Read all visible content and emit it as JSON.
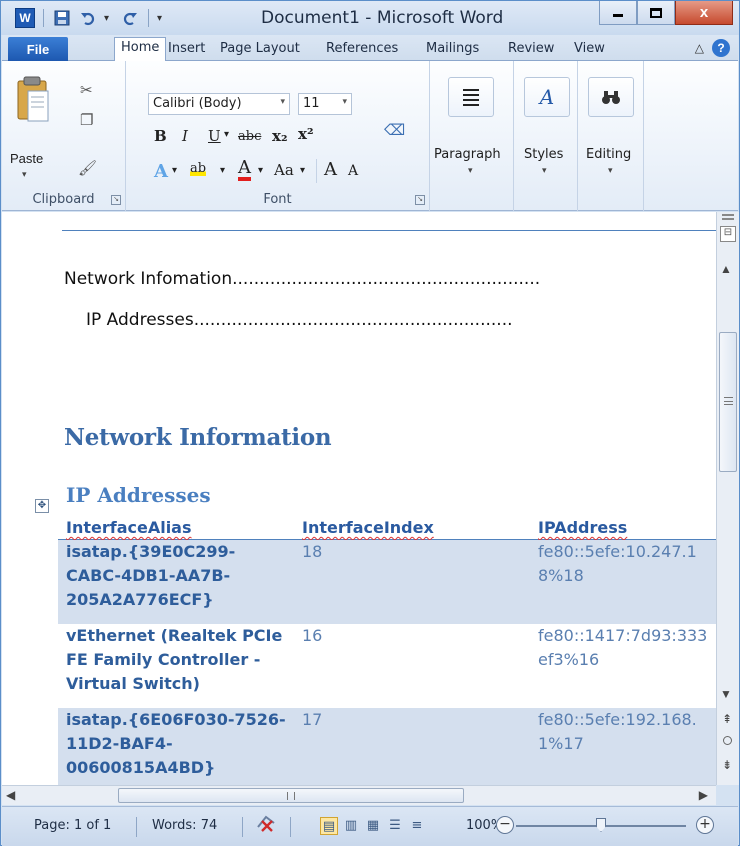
{
  "window": {
    "title": "Document1 - Microsoft Word",
    "close_glyph": "x"
  },
  "quick_access": {
    "app_icon": "W",
    "items": [
      "save-icon",
      "undo-icon",
      "redo-icon",
      "customize-dropdown-icon"
    ]
  },
  "ribbon_tabs": {
    "file": "File",
    "tabs": [
      "Home",
      "Insert",
      "Page Layout",
      "References",
      "Mailings",
      "Review",
      "View"
    ],
    "active": "Home"
  },
  "ribbon": {
    "clipboard": {
      "paste_label": "Paste",
      "group_label": "Clipboard"
    },
    "font": {
      "font_name": "Calibri (Body)",
      "font_size": "11",
      "group_label": "Font",
      "buttons": {
        "bold": "B",
        "italic": "I",
        "underline": "U",
        "strike": "abc",
        "subscript": "x₂",
        "superscript": "x²",
        "font_color": "A",
        "change_case": "Aa",
        "grow": "A",
        "shrink": "A"
      }
    },
    "paragraph": {
      "label": "Paragraph"
    },
    "styles": {
      "label": "Styles"
    },
    "editing": {
      "label": "Editing"
    }
  },
  "document": {
    "toc": [
      {
        "text": "Network Infomation",
        "level": 1
      },
      {
        "text": "IP Addresses",
        "level": 2
      }
    ],
    "heading1": "Network Information",
    "heading2": "IP Addresses",
    "table": {
      "headers": [
        "InterfaceAlias",
        "InterfaceIndex",
        "IPAddress"
      ],
      "rows": [
        {
          "alias": "isatap.{39E0C299-\nCABC-4DB1-AA7B-\n205A2A776ECF}",
          "index": "18",
          "ip": "fe80::5efe:10.247.1\n8%18",
          "shaded": true
        },
        {
          "alias": "vEthernet (Realtek PCIe\nFE Family Controller -\nVirtual Switch)",
          "index": "16",
          "ip": "fe80::1417:7d93:333\nef3%16",
          "shaded": false
        },
        {
          "alias": "isatap.{6E06F030-7526-\n11D2-BAF4-\n00600815A4BD}",
          "index": "17",
          "ip": "fe80::5efe:192.168.\n1%17",
          "shaded": true
        }
      ]
    }
  },
  "status_bar": {
    "page": "Page: 1 of 1",
    "words": "Words: 74",
    "zoom": "100%",
    "zoom_minus": "−",
    "zoom_plus": "+"
  },
  "colors": {
    "heading": "#3b6aa6",
    "table_header": "#2a5aa0",
    "row_shade": "#d4dfee",
    "file_tab": "#1d58b0"
  }
}
